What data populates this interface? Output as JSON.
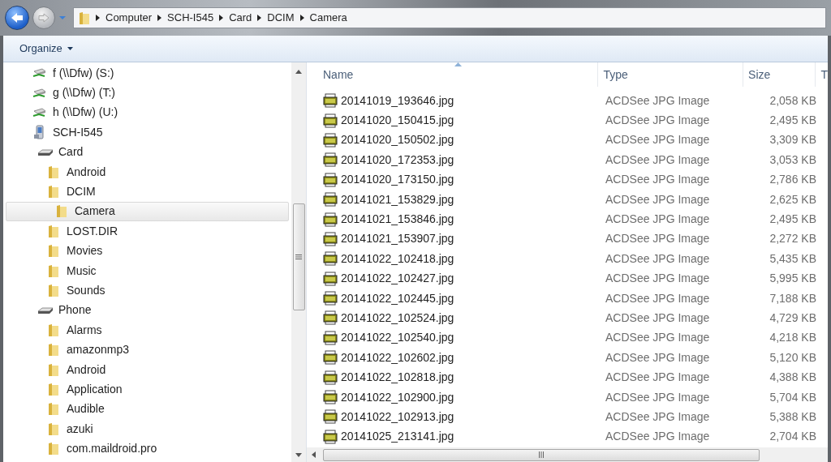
{
  "address_bar": {
    "crumbs": [
      "Computer",
      "SCH-I545",
      "Card",
      "DCIM",
      "Camera"
    ]
  },
  "toolbar": {
    "organize": "Organize"
  },
  "nav_tree": [
    {
      "label": "f (\\\\Dfw) (S:)",
      "kind": "drive",
      "selected": false
    },
    {
      "label": "g (\\\\Dfw) (T:)",
      "kind": "drive",
      "selected": false
    },
    {
      "label": "h (\\\\Dfw) (U:)",
      "kind": "drive",
      "selected": false
    },
    {
      "label": "SCH-I545",
      "kind": "device",
      "selected": false,
      "children": [
        {
          "label": "Card",
          "kind": "storage",
          "selected": false,
          "children": [
            {
              "label": "Android",
              "kind": "folder",
              "selected": false
            },
            {
              "label": "DCIM",
              "kind": "folder",
              "selected": false,
              "children": [
                {
                  "label": "Camera",
                  "kind": "folder",
                  "selected": true
                }
              ]
            },
            {
              "label": "LOST.DIR",
              "kind": "folder",
              "selected": false
            },
            {
              "label": "Movies",
              "kind": "folder",
              "selected": false
            },
            {
              "label": "Music",
              "kind": "folder",
              "selected": false
            },
            {
              "label": "Sounds",
              "kind": "folder",
              "selected": false
            }
          ]
        },
        {
          "label": "Phone",
          "kind": "storage",
          "selected": false,
          "children": [
            {
              "label": "Alarms",
              "kind": "folder",
              "selected": false
            },
            {
              "label": "amazonmp3",
              "kind": "folder",
              "selected": false
            },
            {
              "label": "Android",
              "kind": "folder",
              "selected": false
            },
            {
              "label": "Application",
              "kind": "folder",
              "selected": false
            },
            {
              "label": "Audible",
              "kind": "folder",
              "selected": false
            },
            {
              "label": "azuki",
              "kind": "folder",
              "selected": false
            },
            {
              "label": "com.maildroid.pro",
              "kind": "folder",
              "selected": false
            }
          ]
        }
      ]
    }
  ],
  "file_list": {
    "columns": [
      "Name",
      "Type",
      "Size",
      "T"
    ],
    "rows": [
      {
        "name": "20141019_193646.jpg",
        "type": "ACDSee JPG Image",
        "size": "2,058 KB"
      },
      {
        "name": "20141020_150415.jpg",
        "type": "ACDSee JPG Image",
        "size": "2,495 KB"
      },
      {
        "name": "20141020_150502.jpg",
        "type": "ACDSee JPG Image",
        "size": "3,309 KB"
      },
      {
        "name": "20141020_172353.jpg",
        "type": "ACDSee JPG Image",
        "size": "3,053 KB"
      },
      {
        "name": "20141020_173150.jpg",
        "type": "ACDSee JPG Image",
        "size": "2,786 KB"
      },
      {
        "name": "20141021_153829.jpg",
        "type": "ACDSee JPG Image",
        "size": "2,625 KB"
      },
      {
        "name": "20141021_153846.jpg",
        "type": "ACDSee JPG Image",
        "size": "2,495 KB"
      },
      {
        "name": "20141021_153907.jpg",
        "type": "ACDSee JPG Image",
        "size": "2,272 KB"
      },
      {
        "name": "20141022_102418.jpg",
        "type": "ACDSee JPG Image",
        "size": "5,435 KB"
      },
      {
        "name": "20141022_102427.jpg",
        "type": "ACDSee JPG Image",
        "size": "5,995 KB"
      },
      {
        "name": "20141022_102445.jpg",
        "type": "ACDSee JPG Image",
        "size": "7,188 KB"
      },
      {
        "name": "20141022_102524.jpg",
        "type": "ACDSee JPG Image",
        "size": "4,729 KB"
      },
      {
        "name": "20141022_102540.jpg",
        "type": "ACDSee JPG Image",
        "size": "4,218 KB"
      },
      {
        "name": "20141022_102602.jpg",
        "type": "ACDSee JPG Image",
        "size": "5,120 KB"
      },
      {
        "name": "20141022_102818.jpg",
        "type": "ACDSee JPG Image",
        "size": "4,388 KB"
      },
      {
        "name": "20141022_102900.jpg",
        "type": "ACDSee JPG Image",
        "size": "5,704 KB"
      },
      {
        "name": "20141022_102913.jpg",
        "type": "ACDSee JPG Image",
        "size": "5,388 KB"
      },
      {
        "name": "20141025_213141.jpg",
        "type": "ACDSee JPG Image",
        "size": "2,704 KB"
      }
    ]
  }
}
